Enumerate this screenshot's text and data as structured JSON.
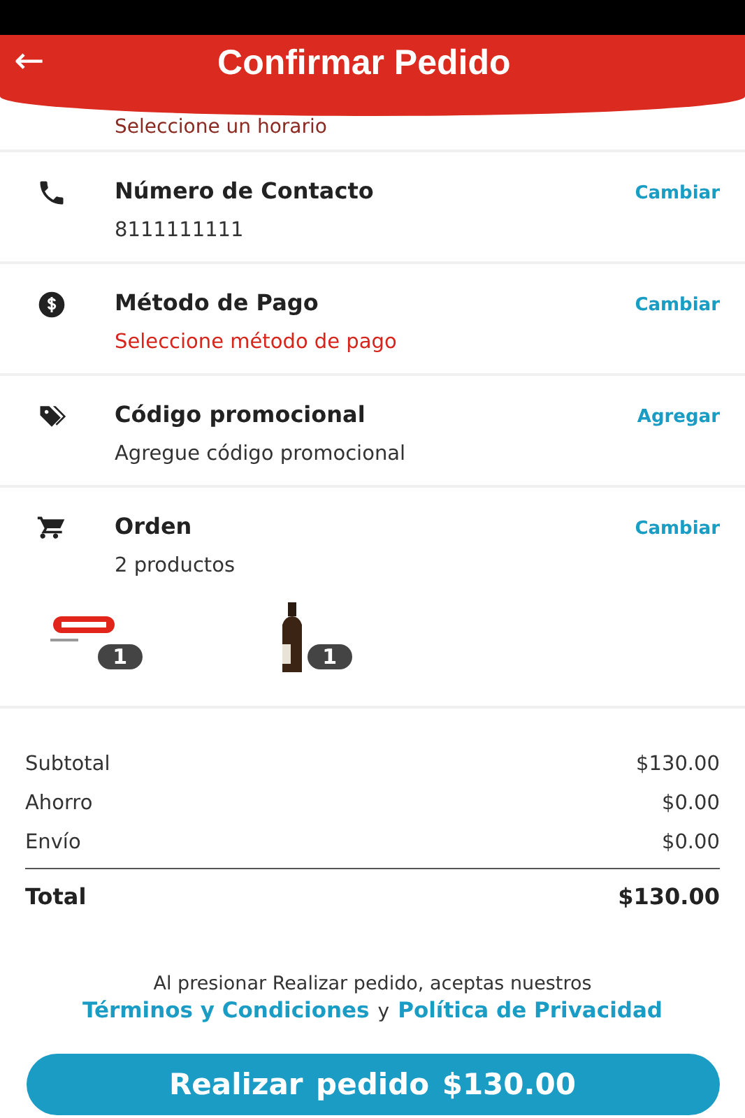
{
  "header": {
    "back": "←",
    "title": "Confirmar Pedido"
  },
  "schedule_hint": "Seleccione un horario",
  "sections": [
    {
      "title": "Número de Contacto",
      "value": "8111111111",
      "warning": false,
      "action": "Cambiar"
    },
    {
      "title": "Método de Pago",
      "value": "Seleccione método de pago",
      "warning": true,
      "action": "Cambiar"
    },
    {
      "title": "Código promocional",
      "value": "Agregue código promocional",
      "warning": false,
      "action": "Agregar"
    },
    {
      "title": "Orden",
      "value": "2 productos",
      "warning": false,
      "action": "Cambiar"
    }
  ],
  "products": [
    {
      "kind": "picture",
      "quantity": "1"
    },
    {
      "kind": "picture",
      "quantity": "1"
    }
  ],
  "totals": [
    {
      "label": "Subtotal",
      "amount": "$130.00"
    },
    {
      "label": "Ahorro",
      "amount": "$0.00"
    },
    {
      "label": "Envío",
      "amount": "$0.00"
    }
  ],
  "total": {
    "label": "Total",
    "amount": "$130.00"
  },
  "terms": {
    "text": "Al presionar Realizar pedido, aceptas nuestros",
    "link1": "Términos y Condiciones",
    "joiner": "y",
    "link2": "Política de Privacidad"
  },
  "submit": {
    "label": "Realizar pedido",
    "amount": "$130.00"
  }
}
